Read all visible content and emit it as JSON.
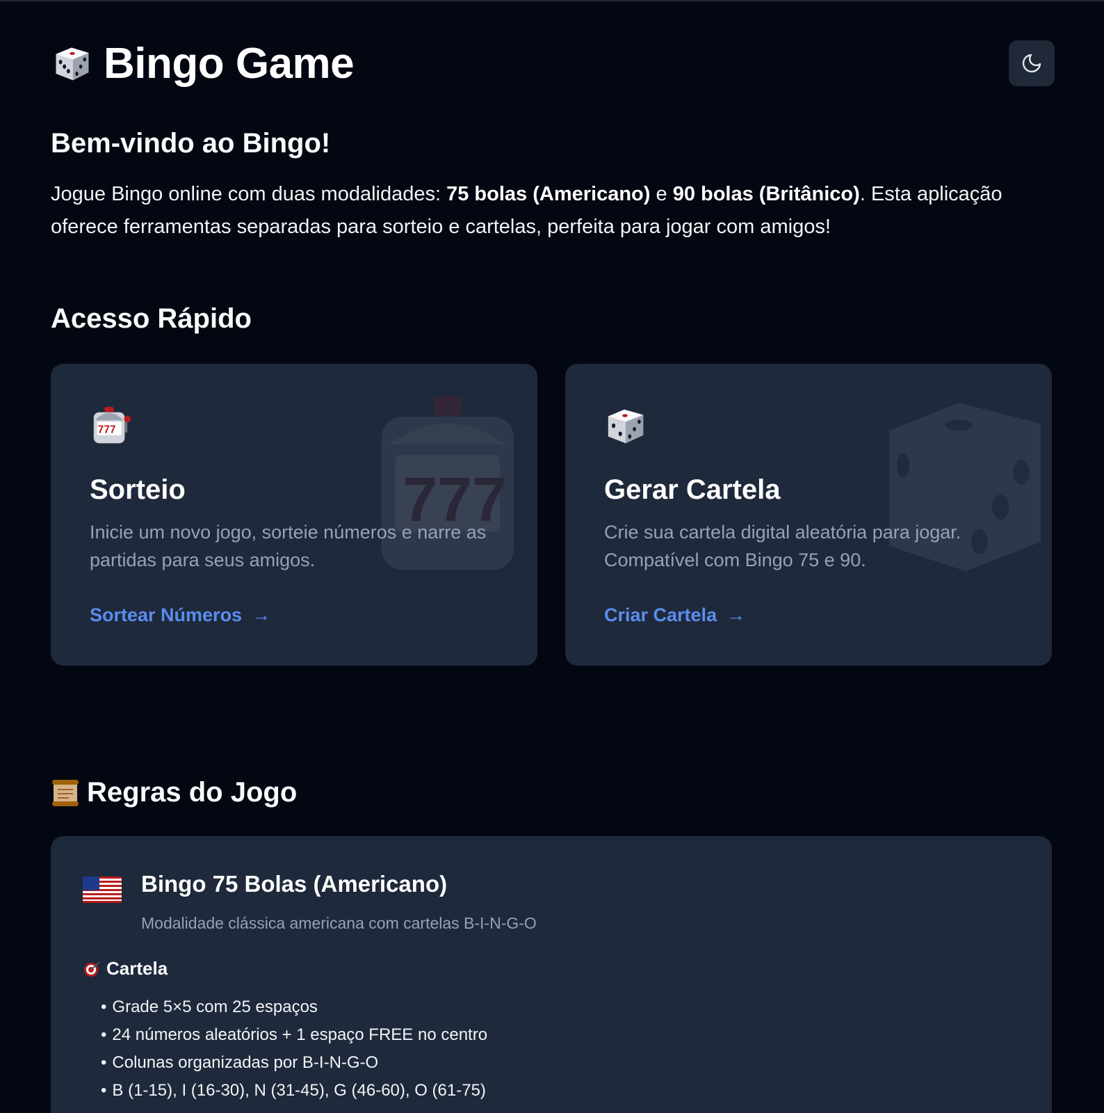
{
  "header": {
    "title": "Bingo Game",
    "logo_icon": "dice-icon",
    "theme_toggle_icon": "moon-icon"
  },
  "welcome": {
    "title": "Bem-vindo ao Bingo!",
    "text_1": "Jogue Bingo online com duas modalidades: ",
    "bold_1": "75 bolas (Americano)",
    "text_2": " e ",
    "bold_2": "90 bolas (Britânico)",
    "text_3": ". Esta aplicação oferece ferramentas separadas para sorteio e cartelas, perfeita para jogar com amigos!"
  },
  "quick_access": {
    "title": "Acesso Rápido",
    "cards": [
      {
        "icon": "slot-machine-icon",
        "title": "Sorteio",
        "description": "Inicie um novo jogo, sorteie números e narre as partidas para seus amigos.",
        "link": "Sortear Números",
        "arrow": "→"
      },
      {
        "icon": "dice-icon",
        "title": "Gerar Cartela",
        "description": "Crie sua cartela digital aleatória para jogar. Compatível com Bingo 75 e 90.",
        "link": "Criar Cartela",
        "arrow": "→"
      }
    ]
  },
  "rules": {
    "title": "Regras do Jogo",
    "icon": "scroll-icon",
    "modes": [
      {
        "flag": "us-flag-icon",
        "title": "Bingo 75 Bolas (Americano)",
        "subtitle": "Modalidade clássica americana com cartelas B-I-N-G-O",
        "section_icon": "target-icon",
        "section_title": "Cartela",
        "items": [
          "Grade 5×5 com 25 espaços",
          "24 números aleatórios + 1 espaço FREE no centro",
          "Colunas organizadas por B-I-N-G-O",
          "B (1-15), I (16-30), N (31-45), G (46-60), O (61-75)"
        ]
      }
    ]
  },
  "colors": {
    "background": "#030712",
    "card": "#1e293b",
    "link": "#5b8def",
    "muted": "#94a3b8"
  }
}
